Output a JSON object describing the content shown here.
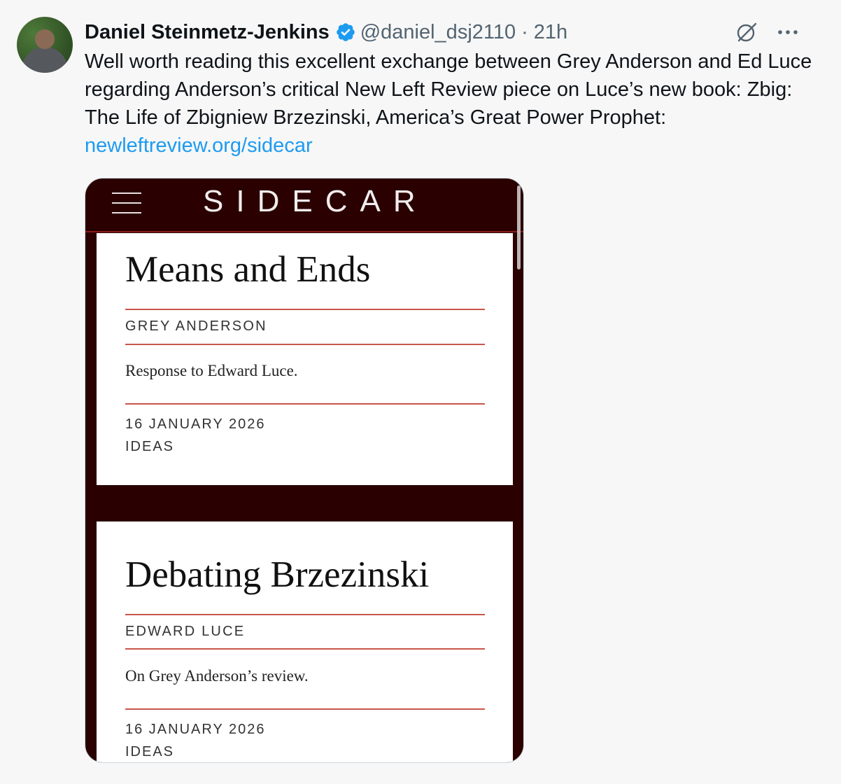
{
  "tweet": {
    "author_name": "Daniel Steinmetz-Jenkins",
    "handle": "@daniel_dsj2110",
    "separator": "·",
    "time": "21h",
    "text": "Well worth reading this excellent exchange between Grey Anderson and Ed Luce regarding Anderson’s critical New Left Review piece on Luce’s new book: Zbig: The Life of Zbigniew Brzezinski, America’s Great Power Prophet:",
    "link": "newleftreview.org/sidecar",
    "more_label": "···"
  },
  "media": {
    "site_title": "SIDECAR",
    "articles": [
      {
        "title": "Means and Ends",
        "author": "GREY ANDERSON",
        "summary": "Response to Edward Luce.",
        "date": "16 JANUARY 2026",
        "section": "IDEAS"
      },
      {
        "title": "Debating Brzezinski",
        "author": "EDWARD LUCE",
        "summary": "On Grey Anderson’s review.",
        "date": "16 JANUARY 2026",
        "section": "IDEAS"
      }
    ]
  },
  "colors": {
    "link": "#1d9bf0",
    "verified": "#1d9bf0",
    "sidecar_bg": "#2a0000",
    "rule": "#c9564c"
  },
  "icons": [
    "verified-badge-icon",
    "grok-icon",
    "more-icon",
    "hamburger-menu-icon"
  ]
}
